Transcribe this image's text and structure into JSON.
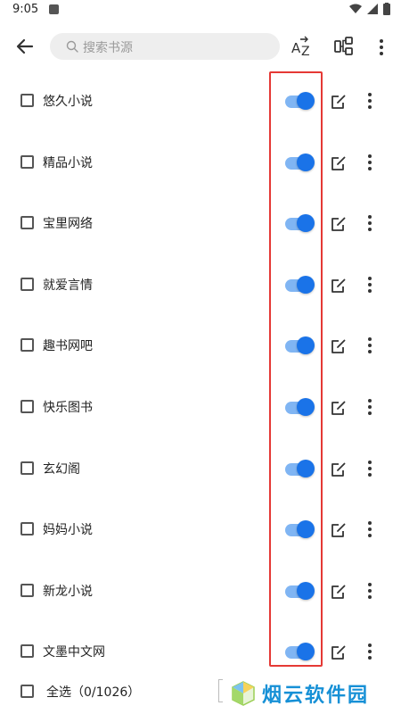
{
  "status_bar": {
    "time": "9:05"
  },
  "app_bar": {
    "search_placeholder": "搜索书源"
  },
  "sources": [
    {
      "name": "悠久小说",
      "enabled": true,
      "checked": false
    },
    {
      "name": "精品小说",
      "enabled": true,
      "checked": false
    },
    {
      "name": "宝里网络",
      "enabled": true,
      "checked": false
    },
    {
      "name": "就爱言情",
      "enabled": true,
      "checked": false
    },
    {
      "name": "趣书网吧",
      "enabled": true,
      "checked": false
    },
    {
      "name": "快乐图书",
      "enabled": true,
      "checked": false
    },
    {
      "name": "玄幻阁",
      "enabled": true,
      "checked": false
    },
    {
      "name": "妈妈小说",
      "enabled": true,
      "checked": false
    },
    {
      "name": "新龙小说",
      "enabled": true,
      "checked": false
    },
    {
      "name": "文墨中文网",
      "enabled": true,
      "checked": false
    }
  ],
  "footer": {
    "select_all_label": "全选（0/1026）"
  },
  "watermark": {
    "text": "烟云软件园"
  },
  "colors": {
    "accent": "#1a73e8",
    "highlight": "#e53935"
  }
}
